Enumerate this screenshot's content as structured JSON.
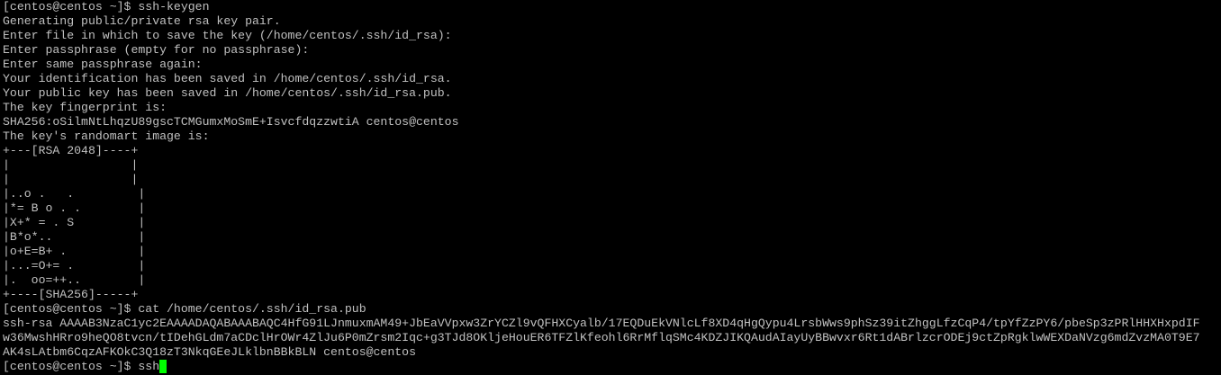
{
  "terminal": {
    "lines": [
      "[centos@centos ~]$ ssh-keygen",
      "Generating public/private rsa key pair.",
      "Enter file in which to save the key (/home/centos/.ssh/id_rsa):",
      "Enter passphrase (empty for no passphrase):",
      "Enter same passphrase again:",
      "Your identification has been saved in /home/centos/.ssh/id_rsa.",
      "Your public key has been saved in /home/centos/.ssh/id_rsa.pub.",
      "The key fingerprint is:",
      "SHA256:oSilmNtLhqzU89gscTCMGumxMoSmE+IsvcfdqzzwtiA centos@centos",
      "The key's randomart image is:",
      "+---[RSA 2048]----+",
      "|                 |",
      "|                 |",
      "|..o .   .         |",
      "|*= B o . .        |",
      "|X+* = . S         |",
      "|B*o*..            |",
      "|o+E=B+ .          |",
      "|...=O+= .         |",
      "|.  oo=++..        |",
      "+----[SHA256]-----+",
      "[centos@centos ~]$ cat /home/centos/.ssh/id_rsa.pub",
      "ssh-rsa AAAAB3NzaC1yc2EAAAADAQABAAABAQC4HfG91LJnmuxmAM49+JbEaVVpxw3ZrYCZl9vQFHXCyalb/17EQDuEkVNlcLf8XD4qHgQypu4LrsbWws9phSz39itZhggLfzCqP4/tpYfZzPY6/pbeSp3zPRlHHXHxpdIF",
      "w36MwshHRro9heQO8tvcn/tIDehGLdm7aCDclHrOWr4ZlJu6P0mZrsm2Iqc+g3TJd8OKljeHouER6TFZlKfeohl6RrMflqSMc4KDZJIKQAudAIayUyBBwvxr6Rt1dABrlzcrODEj9ctZpRgklwWEXDaNVzg6mdZvzMA0T9E7",
      "AK4sLAtbm6CqzAFKOkC3Q18zT3NkqGEeJLklbnBBkBLN centos@centos"
    ],
    "current_prompt": "[centos@centos ~]$ ",
    "current_input": "ssh",
    "colors": {
      "background": "#000000",
      "text": "#c0c0c0",
      "cursor": "#00ff00"
    }
  }
}
